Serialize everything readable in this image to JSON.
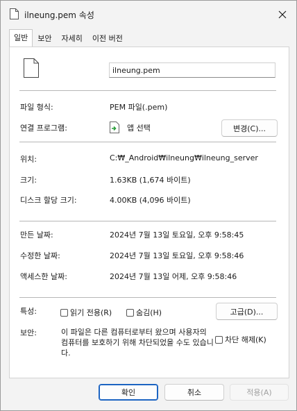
{
  "window": {
    "title": "ilneung.pem 속성"
  },
  "tabs": [
    "일반",
    "보안",
    "자세히",
    "이전 버전"
  ],
  "general": {
    "file_name": "ilneung.pem",
    "file_type_label": "파일 형식:",
    "file_type_value": "PEM 파일(.pem)",
    "opens_with_label": "연결 프로그램:",
    "opens_with_value": "앱 선택",
    "change_button": "변경(C)...",
    "location_label": "위치:",
    "location_value": "C:₩_Android₩ilneung₩ilneung_server",
    "size_label": "크기:",
    "size_value": "1.63KB (1,674 바이트)",
    "size_on_disk_label": "디스크 할당 크기:",
    "size_on_disk_value": "4.00KB (4,096 바이트)",
    "created_label": "만든 날짜:",
    "created_value": "2024년 7월 13일 토요일, 오후 9:58:45",
    "modified_label": "수정한 날짜:",
    "modified_value": "2024년 7월 13일 토요일, 오후 9:58:46",
    "accessed_label": "액세스한 날짜:",
    "accessed_value": "2024년 7월 13일 어제, 오후 9:58:46",
    "attributes_label": "특성:",
    "readonly_label": "읽기 전용(R)",
    "readonly_checked": false,
    "hidden_label": "숨김(H)",
    "hidden_checked": false,
    "advanced_button": "고급(D)...",
    "security_label": "보안:",
    "security_text": "이 파일은 다른 컴퓨터로부터 왔으며 사용자의 컴퓨터를 보호하기 위해 차단되었을 수도 있습니다.",
    "unblock_label": "차단 해제(K)",
    "unblock_checked": false
  },
  "footer": {
    "ok": "확인",
    "cancel": "취소",
    "apply": "적용(A)"
  },
  "colors": {
    "window_bg": "#f3f3f3",
    "panel_bg": "#ffffff",
    "accent": "#1c64c2"
  }
}
